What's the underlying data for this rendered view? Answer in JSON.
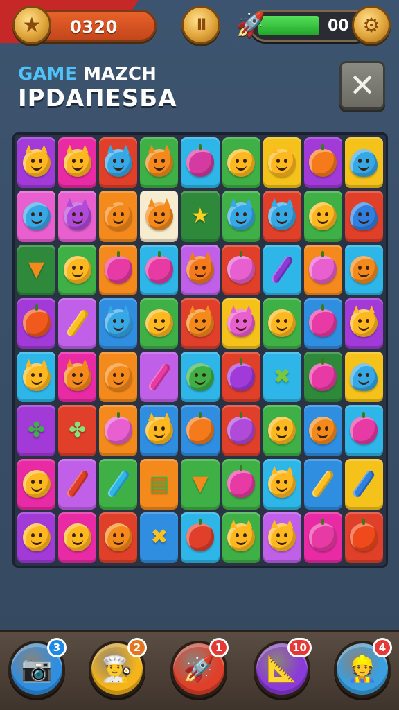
{
  "hud": {
    "score": "0320",
    "energy_value": "00",
    "energy_fill_fraction": 0.55,
    "pause_symbol": "II",
    "star_icon": "★",
    "rocket_icon": "🚀",
    "settings_icon": "⚙"
  },
  "titles": {
    "game_title_word1": "GAME",
    "game_title_word2": "MAZCH",
    "subtitle": "IPDAПESБA"
  },
  "close_symbol": "✕",
  "colors": {
    "purple": "#a23ad8",
    "magenta": "#e82aa4",
    "red": "#e0402a",
    "green": "#3fb046",
    "cyan": "#2fb6e8",
    "yellow": "#f4c21a",
    "orange": "#f58a1c",
    "pink": "#e85fd0",
    "blue": "#2f8ee0",
    "lilac": "#c060e8",
    "darkgreen": "#2e8a3a",
    "cream": "#f6eccf"
  },
  "board": {
    "rows": [
      [
        {
          "t": "purple",
          "c": "#ffb820",
          "k": "face-ears"
        },
        {
          "t": "magenta",
          "c": "#ffb820",
          "k": "face-ears"
        },
        {
          "t": "red",
          "c": "#37a8e6",
          "k": "face-ears"
        },
        {
          "t": "green",
          "c": "#f58a1c",
          "k": "face-ears"
        },
        {
          "t": "cyan",
          "c": "#d43aa0",
          "k": "fruit"
        },
        {
          "t": "green",
          "c": "#ffb820",
          "k": "face"
        },
        {
          "t": "yellow",
          "c": "#ffb820",
          "k": "face-ears"
        },
        {
          "t": "purple",
          "c": "#f57a1c",
          "k": "fruit"
        },
        {
          "t": "yellow",
          "c": "#37a8e6",
          "k": "drop"
        }
      ],
      [
        {
          "t": "pink",
          "c": "#37a8e6",
          "k": "face"
        },
        {
          "t": "pink",
          "c": "#b04ad8",
          "k": "face-ears"
        },
        {
          "t": "orange",
          "c": "#f58a1c",
          "k": "face-ears"
        },
        {
          "t": "cream",
          "c": "#f58a1c",
          "k": "face-ears"
        },
        {
          "t": "darkgreen",
          "c": "#ffd020",
          "k": "star"
        },
        {
          "t": "green",
          "c": "#37a8e6",
          "k": "face-ears"
        },
        {
          "t": "red",
          "c": "#37a8e6",
          "k": "face-ears"
        },
        {
          "t": "green",
          "c": "#ffb820",
          "k": "face"
        },
        {
          "t": "red",
          "c": "#2f80e0",
          "k": "drop"
        }
      ],
      [
        {
          "t": "darkgreen",
          "c": "#f58a1c",
          "k": "carrot"
        },
        {
          "t": "green",
          "c": "#ffb820",
          "k": "face"
        },
        {
          "t": "orange",
          "c": "#e83aa4",
          "k": "fruit"
        },
        {
          "t": "cyan",
          "c": "#e83aa4",
          "k": "fruit"
        },
        {
          "t": "lilac",
          "c": "#f57a1c",
          "k": "face-ears"
        },
        {
          "t": "red",
          "c": "#e85fd0",
          "k": "fruit"
        },
        {
          "t": "cyan",
          "c": "#8a3ad8",
          "k": "pencil"
        },
        {
          "t": "orange",
          "c": "#e85fd0",
          "k": "fruit"
        },
        {
          "t": "cyan",
          "c": "#f58a1c",
          "k": "face"
        }
      ],
      [
        {
          "t": "purple",
          "c": "#f05a1c",
          "k": "fruit"
        },
        {
          "t": "lilac",
          "c": "#ffc020",
          "k": "pencil"
        },
        {
          "t": "blue",
          "c": "#37a8e6",
          "k": "face-ears"
        },
        {
          "t": "green",
          "c": "#ffb820",
          "k": "face"
        },
        {
          "t": "red",
          "c": "#f58a1c",
          "k": "face-ears"
        },
        {
          "t": "yellow",
          "c": "#e85fd0",
          "k": "face-ears"
        },
        {
          "t": "green",
          "c": "#ffb820",
          "k": "face"
        },
        {
          "t": "blue",
          "c": "#e83aa4",
          "k": "fruit"
        },
        {
          "t": "purple",
          "c": "#ffb820",
          "k": "face-ears"
        }
      ],
      [
        {
          "t": "cyan",
          "c": "#ffb820",
          "k": "face-ears"
        },
        {
          "t": "magenta",
          "c": "#f58a1c",
          "k": "face-ears"
        },
        {
          "t": "orange",
          "c": "#f58a1c",
          "k": "face"
        },
        {
          "t": "lilac",
          "c": "#e83aa4",
          "k": "pencil"
        },
        {
          "t": "cyan",
          "c": "#3fb046",
          "k": "face"
        },
        {
          "t": "red",
          "c": "#a03ad8",
          "k": "fruit"
        },
        {
          "t": "cyan",
          "c": "#7ac83a",
          "k": "cross"
        },
        {
          "t": "darkgreen",
          "c": "#e83aa4",
          "k": "fruit"
        },
        {
          "t": "yellow",
          "c": "#37a8e6",
          "k": "drop"
        }
      ],
      [
        {
          "t": "purple",
          "c": "#3fb046",
          "k": "leaf"
        },
        {
          "t": "red",
          "c": "#8ae07a",
          "k": "leaf"
        },
        {
          "t": "orange",
          "c": "#e85fd0",
          "k": "fruit"
        },
        {
          "t": "blue",
          "c": "#ffb820",
          "k": "face-ears"
        },
        {
          "t": "blue",
          "c": "#f57a1c",
          "k": "fruit"
        },
        {
          "t": "red",
          "c": "#b04ad8",
          "k": "fruit"
        },
        {
          "t": "green",
          "c": "#ffb820",
          "k": "face"
        },
        {
          "t": "blue",
          "c": "#f58a1c",
          "k": "face"
        },
        {
          "t": "cyan",
          "c": "#e83aa4",
          "k": "fruit"
        }
      ],
      [
        {
          "t": "magenta",
          "c": "#ffb820",
          "k": "face"
        },
        {
          "t": "lilac",
          "c": "#e0402a",
          "k": "pencil"
        },
        {
          "t": "green",
          "c": "#2fb6e8",
          "k": "pencil"
        },
        {
          "t": "orange",
          "c": "#3fb046",
          "k": "stripes"
        },
        {
          "t": "green",
          "c": "#f58a1c",
          "k": "carrot"
        },
        {
          "t": "green",
          "c": "#e83aa4",
          "k": "fruit"
        },
        {
          "t": "cyan",
          "c": "#ffb820",
          "k": "face-ears"
        },
        {
          "t": "blue",
          "c": "#ffc020",
          "k": "pencil"
        },
        {
          "t": "yellow",
          "c": "#2f80e0",
          "k": "pencil"
        }
      ],
      [
        {
          "t": "purple",
          "c": "#ffb820",
          "k": "face"
        },
        {
          "t": "magenta",
          "c": "#ffb820",
          "k": "face"
        },
        {
          "t": "red",
          "c": "#f58a1c",
          "k": "face"
        },
        {
          "t": "blue",
          "c": "#ffc020",
          "k": "cross"
        },
        {
          "t": "cyan",
          "c": "#e0402a",
          "k": "fruit"
        },
        {
          "t": "green",
          "c": "#ffb820",
          "k": "face-ears"
        },
        {
          "t": "lilac",
          "c": "#ffb820",
          "k": "face-ears"
        },
        {
          "t": "magenta",
          "c": "#e83aa4",
          "k": "fruit"
        },
        {
          "t": "red",
          "c": "#f04a1c",
          "k": "fruit"
        }
      ]
    ]
  },
  "boosters": [
    {
      "name": "camera-booster",
      "icon": "📷",
      "count": "3",
      "bg": "#2f8ee0",
      "badge": "blue"
    },
    {
      "name": "chef-booster",
      "icon": "👨‍🍳",
      "count": "2",
      "bg": "#f4b41a",
      "badge": "orange"
    },
    {
      "name": "rocket-booster",
      "icon": "🚀",
      "count": "1",
      "bg": "#e0402a",
      "badge": "red"
    },
    {
      "name": "hammer-booster",
      "icon": "📐",
      "count": "10",
      "bg": "#8a3ad8",
      "badge": "red"
    },
    {
      "name": "builder-booster",
      "icon": "👷",
      "count": "4",
      "bg": "#3aa0e0",
      "badge": "red"
    }
  ]
}
